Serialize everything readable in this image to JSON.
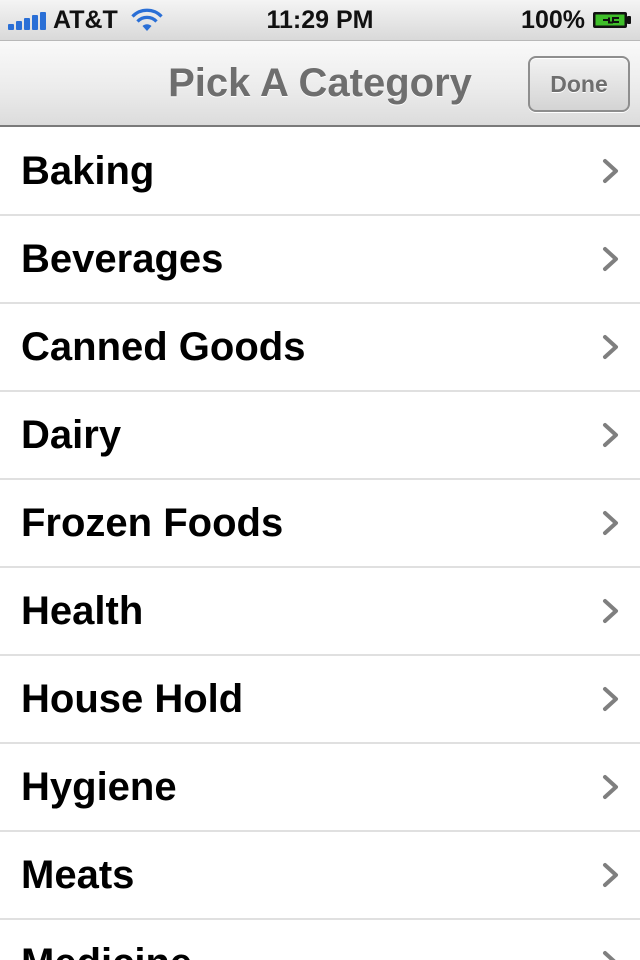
{
  "status_bar": {
    "carrier": "AT&T",
    "time": "11:29 PM",
    "battery": "100%",
    "signal_icon": "signal-bars-icon",
    "wifi_icon": "wifi-icon",
    "battery_icon": "battery-charging-icon"
  },
  "nav_bar": {
    "title": "Pick A Category",
    "done_label": "Done"
  },
  "categories": [
    {
      "label": "Baking"
    },
    {
      "label": "Beverages"
    },
    {
      "label": "Canned Goods"
    },
    {
      "label": "Dairy"
    },
    {
      "label": "Frozen Foods"
    },
    {
      "label": "Health"
    },
    {
      "label": "House Hold"
    },
    {
      "label": "Hygiene"
    },
    {
      "label": "Meats"
    },
    {
      "label": "Medicine"
    }
  ],
  "colors": {
    "signal": "#2a6fd6",
    "battery_fill": "#3fbf2a",
    "nav_title": "#6e6e6e",
    "row_separator": "#e0e0e0",
    "chevron": "#7f7f7f"
  }
}
